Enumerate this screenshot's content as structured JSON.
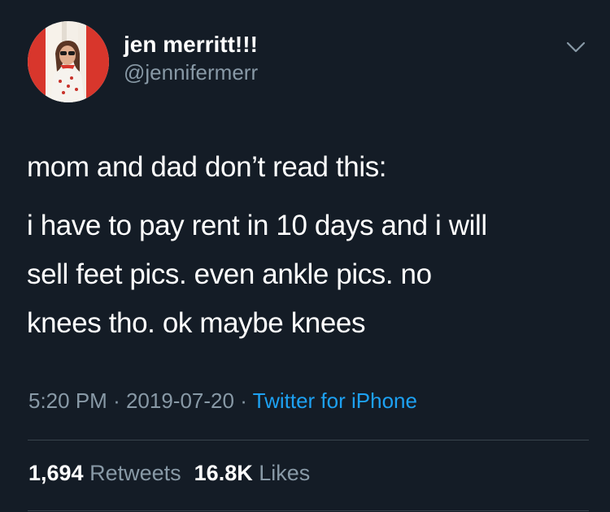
{
  "user": {
    "display_name": "jen merritt!!!",
    "handle": "@jennifermerr"
  },
  "tweet": {
    "paragraph_1": "mom and dad don’t read this:",
    "paragraph_2_line_1": "i have to pay rent in 10 days and i will",
    "paragraph_2_line_2": "sell feet pics. even ankle pics. no",
    "paragraph_2_line_3": "knees tho. ok maybe knees",
    "time": "5:20 PM",
    "separator": "·",
    "date": "2019-07-20",
    "source": "Twitter for iPhone"
  },
  "stats": {
    "retweets_count": "1,694",
    "retweets_label": "Retweets",
    "likes_count": "16.8K",
    "likes_label": "Likes"
  },
  "icons": {
    "caret": "chevron-down-icon"
  },
  "colors": {
    "background": "#141c26",
    "text": "#ffffff",
    "secondary": "#8899a6",
    "link": "#1da1f2",
    "divider": "#38444d"
  }
}
